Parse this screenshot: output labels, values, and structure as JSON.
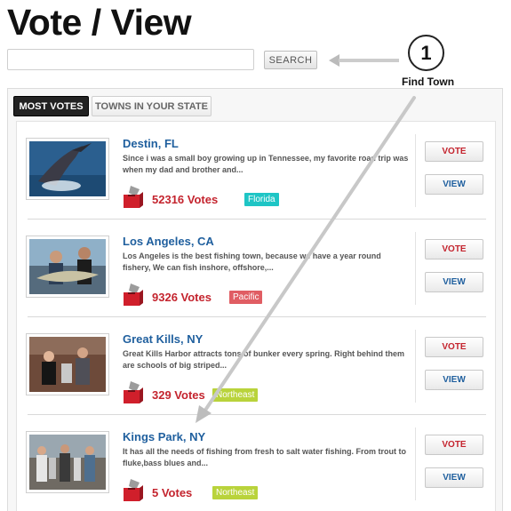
{
  "page": {
    "title": "Vote / View"
  },
  "search": {
    "placeholder": "",
    "button_label": "SEARCH"
  },
  "callout": {
    "number": "1",
    "label": "Find Town"
  },
  "tabs": [
    {
      "label": "MOST VOTES",
      "active": true
    },
    {
      "label": "TOWNS IN YOUR STATE",
      "active": false
    }
  ],
  "towns": [
    {
      "name": "Destin, FL",
      "description": "Since i was a small boy growing up in Tennessee, my favorite road trip was when my dad and brother and...",
      "votes": "52316 Votes",
      "region": "Florida",
      "region_color": "#1ec5c5",
      "vote_label": "VOTE",
      "view_label": "VIEW"
    },
    {
      "name": "Los Angeles, CA",
      "description": "Los Angeles is the best fishing town, because we have a year round fishery, We can fish inshore, offshore,...",
      "votes": "9326 Votes",
      "region": "Pacific",
      "region_color": "#e05d63",
      "vote_label": "VOTE",
      "view_label": "VIEW"
    },
    {
      "name": "Great Kills, NY",
      "description": "Great Kills Harbor attracts tons of bunker every spring. Right behind them are schools of big striped...",
      "votes": "329 Votes",
      "region": "Northeast",
      "region_color": "#b9d33b",
      "vote_label": "VOTE",
      "view_label": "VIEW"
    },
    {
      "name": "Kings Park, NY",
      "description": "It has all the needs of fishing from fresh to salt water fishing. From trout to fluke,bass blues and...",
      "votes": "5 Votes",
      "region": "Northeast",
      "region_color": "#b9d33b",
      "vote_label": "VOTE",
      "view_label": "VIEW"
    }
  ],
  "colors": {
    "accent_red": "#c4242e",
    "link_blue": "#1f5f9e"
  },
  "icons": {
    "ballot": "ballot-box-icon"
  }
}
